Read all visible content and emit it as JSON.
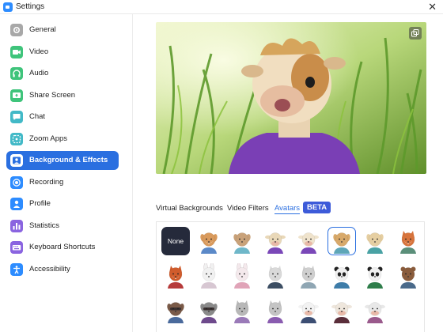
{
  "window": {
    "title": "Settings",
    "close_glyph": "✕"
  },
  "sidebar": {
    "items": [
      {
        "label": "General",
        "icon": "gear-icon",
        "color": "#a8a8a8"
      },
      {
        "label": "Video",
        "icon": "video-camera-icon",
        "color": "#3fc47b"
      },
      {
        "label": "Audio",
        "icon": "headphones-icon",
        "color": "#3fc47b"
      },
      {
        "label": "Share Screen",
        "icon": "share-screen-icon",
        "color": "#3fc47b"
      },
      {
        "label": "Chat",
        "icon": "chat-bubble-icon",
        "color": "#42b9c7"
      },
      {
        "label": "Zoom Apps",
        "icon": "apps-icon",
        "color": "#42b9c7"
      },
      {
        "label": "Background & Effects",
        "icon": "person-background-icon",
        "color": "#ffffff",
        "active": true
      },
      {
        "label": "Recording",
        "icon": "record-icon",
        "color": "#2d8cff"
      },
      {
        "label": "Profile",
        "icon": "profile-icon",
        "color": "#2d8cff"
      },
      {
        "label": "Statistics",
        "icon": "statistics-icon",
        "color": "#8a64e0"
      },
      {
        "label": "Keyboard Shortcuts",
        "icon": "keyboard-icon",
        "color": "#8a64e0"
      },
      {
        "label": "Accessibility",
        "icon": "accessibility-icon",
        "color": "#2d8cff"
      }
    ]
  },
  "tabs": {
    "virtual_backgrounds": "Virtual Backgrounds",
    "video_filters": "Video Filters",
    "avatars": "Avatars",
    "beta": "BETA"
  },
  "avatars": {
    "none_label": "None",
    "selected_index": 4,
    "items": [
      {
        "animal": "corgi",
        "fur": "#d99a5c",
        "shirt": "#5b89c8"
      },
      {
        "animal": "dog",
        "fur": "#c9a27a",
        "shirt": "#6fb7c9"
      },
      {
        "animal": "cow",
        "fur": "#e9d8b8",
        "shirt": "#7a48b8"
      },
      {
        "animal": "cow",
        "fur": "#efe3cc",
        "shirt": "#7a48b8"
      },
      {
        "animal": "dog",
        "fur": "#d8a96a",
        "shirt": "#5ea6b8"
      },
      {
        "animal": "dog",
        "fur": "#e6cfa2",
        "shirt": "#49a2a4"
      },
      {
        "animal": "fox",
        "fur": "#d8743c",
        "shirt": "#5b8f7a"
      },
      {
        "animal": "fox",
        "fur": "#d05c2c",
        "shirt": "#b63a3a"
      },
      {
        "animal": "rabbit",
        "fur": "#f1f1f1",
        "shirt": "#d7c7d2"
      },
      {
        "animal": "rabbit",
        "fur": "#f4e9ec",
        "shirt": "#e0a4b8"
      },
      {
        "animal": "cat",
        "fur": "#d9d9d9",
        "shirt": "#3c4e63"
      },
      {
        "animal": "cat",
        "fur": "#cfcfcf",
        "shirt": "#8fa6b3"
      },
      {
        "animal": "panda",
        "fur": "#f0f0f0",
        "shirt": "#3e7ca8"
      },
      {
        "animal": "panda",
        "fur": "#f0f0f0",
        "shirt": "#2e7d4a"
      },
      {
        "animal": "bear",
        "fur": "#8a5c3c",
        "shirt": "#4a6a8a"
      },
      {
        "animal": "raccoon",
        "fur": "#7a5a48",
        "shirt": "#4a6a9c"
      },
      {
        "animal": "raccoon",
        "fur": "#8a8a8a",
        "shirt": "#6e4a8c"
      },
      {
        "animal": "cat",
        "fur": "#b8b8b8",
        "shirt": "#9a7ab8"
      },
      {
        "animal": "cat",
        "fur": "#c4c4c4",
        "shirt": "#8a5cb0"
      },
      {
        "animal": "cow",
        "fur": "#f2f2f2",
        "shirt": "#3c4e73"
      },
      {
        "animal": "cow",
        "fur": "#eee6dc",
        "shirt": "#5a2e3a"
      },
      {
        "animal": "cow",
        "fur": "#e8e8e8",
        "shirt": "#9a5a8c"
      }
    ]
  },
  "colors": {
    "accent": "#2a6fe0",
    "beta_badge": "#3d5bd9",
    "none_tile": "#252a3b"
  }
}
